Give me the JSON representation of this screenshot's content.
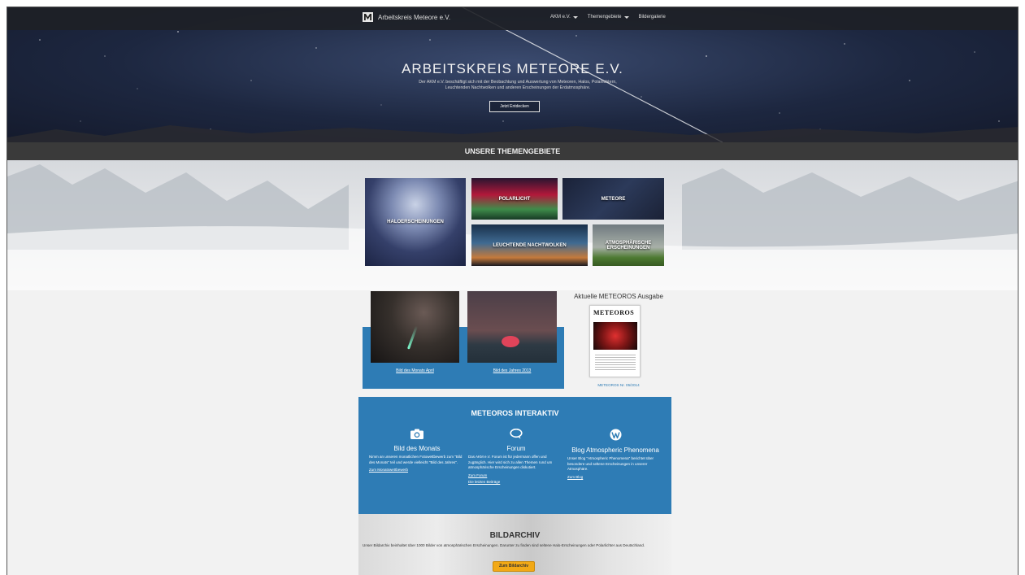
{
  "nav": {
    "brand": "Arbeitskreis Meteore e.V.",
    "items": [
      {
        "label": "AKM e.V.",
        "dropdown": true
      },
      {
        "label": "Themengebiete",
        "dropdown": true
      },
      {
        "label": "Bildergalerie",
        "dropdown": false
      }
    ]
  },
  "hero": {
    "title": "ARBEITSKREIS METEORE E.V.",
    "description": "Der AKM e.V. beschäftigt sich mit der Beobachtung und Auswertung von Meteoren, Halos, Polarlichtern, Leuchtenden Nachtwolken und anderen Erscheinungen der Erdatmosphäre.",
    "button": "Jetzt Entdecken"
  },
  "topics": {
    "heading": "UNSERE THEMENGEBIETE",
    "tiles": {
      "halo": "HALOERSCHEINUNGEN",
      "polar": "POLARLICHT",
      "meteor": "METEORE",
      "nlc": "LEUCHTENDE NACHTWOLKEN",
      "atmo": "ATMOSPHÄRISCHE ERSCHEINUNGEN"
    }
  },
  "pictures": {
    "month_link": "Bild des Monats April",
    "year_link": "Bild des Jahres 2013"
  },
  "issue": {
    "title": "Aktuelle METEOROS Ausgabe",
    "cover_heading": "METEOROS",
    "caption": "METEOROS Nr. 05/2014"
  },
  "interaktiv": {
    "title": "METEOROS INTERAKTIV",
    "columns": [
      {
        "icon": "camera-icon",
        "heading": "Bild des Monats",
        "text": "Nimm an unseren monatlichen Fotowettbewerb zum \"Bild des Monats\" teil und werde vielleicht \"Bild des Jahres\".",
        "links": [
          "Zum Monatswettbewerb"
        ]
      },
      {
        "icon": "chat-bubble-icon",
        "heading": "Forum",
        "text": "Das AKM e.V. Forum ist für jedermann offen und zugänglich. Hier wird sich zu allen Themen rund um atmosphärische Erscheinungen diskutiert.",
        "links": [
          "Zum Forum",
          "Die letzten Beiträge"
        ]
      },
      {
        "icon": "wordpress-icon",
        "heading": "Blog Atmospheric Phenomena",
        "text": "Unser Blog \"Atmospheric Phenomena\" berichtet über besondere und seltene Erscheinungen in unserer Atmosphäre.",
        "links": [
          "Zum Blog"
        ]
      }
    ]
  },
  "archiv": {
    "title": "BILDARCHIV",
    "text": "Unser Bildarchiv beinhaltet über 1000 Bilder von atmosphärischen Erscheinungen. Darunter zu finden sind seltene Halo-Erscheinungen oder Polarlichter aus Deutschland.",
    "button": "Zum Bildarchiv"
  },
  "colors": {
    "accent_blue": "#2e7cb5",
    "button_yellow": "#f2a916",
    "section_bar": "#3a3a3a"
  }
}
